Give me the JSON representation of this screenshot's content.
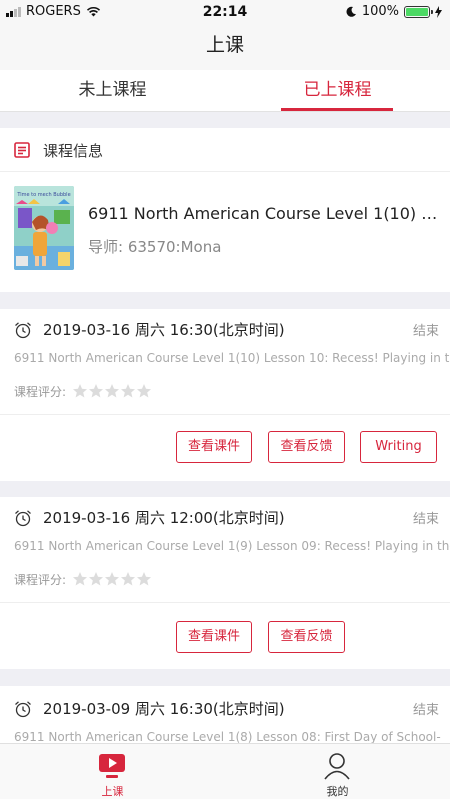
{
  "status_bar": {
    "carrier": "ROGERS",
    "time": "22:14",
    "battery": "100%"
  },
  "nav": {
    "title": "上课"
  },
  "tabs": [
    {
      "label": "未上课程",
      "active": false
    },
    {
      "label": "已上课程",
      "active": true
    }
  ],
  "course_info": {
    "header": "课程信息",
    "title": "6911 North American Course Level 1(10) L...",
    "teacher": "导师: 63570:Mona",
    "thumbnail_caption": "Time to mech Bubble"
  },
  "lessons": [
    {
      "datetime": "2019-03-16 周六 16:30(北京时间)",
      "status": "结束",
      "description": "6911 North American Course Level 1(10) Lesson 10: Recess! Playing in the",
      "rating_label": "课程评分:",
      "rating": 0,
      "buttons": [
        "查看课件",
        "查看反馈",
        "Writing"
      ]
    },
    {
      "datetime": "2019-03-16 周六 12:00(北京时间)",
      "status": "结束",
      "description": "6911 North American Course Level 1(9) Lesson 09: Recess! Playing in the",
      "rating_label": "课程评分:",
      "rating": 0,
      "buttons": [
        "查看课件",
        "查看反馈"
      ]
    },
    {
      "datetime": "2019-03-09 周六 16:30(北京时间)",
      "status": "结束",
      "description": "6911 North American Course Level 1(8) Lesson 08: First Day of School-"
    }
  ],
  "tab_bar": [
    {
      "label": "上课",
      "icon": "play-screen-icon",
      "active": true
    },
    {
      "label": "我的",
      "icon": "user-icon",
      "active": false
    }
  ],
  "colors": {
    "accent": "#d7263d",
    "battery": "#4cd964"
  }
}
